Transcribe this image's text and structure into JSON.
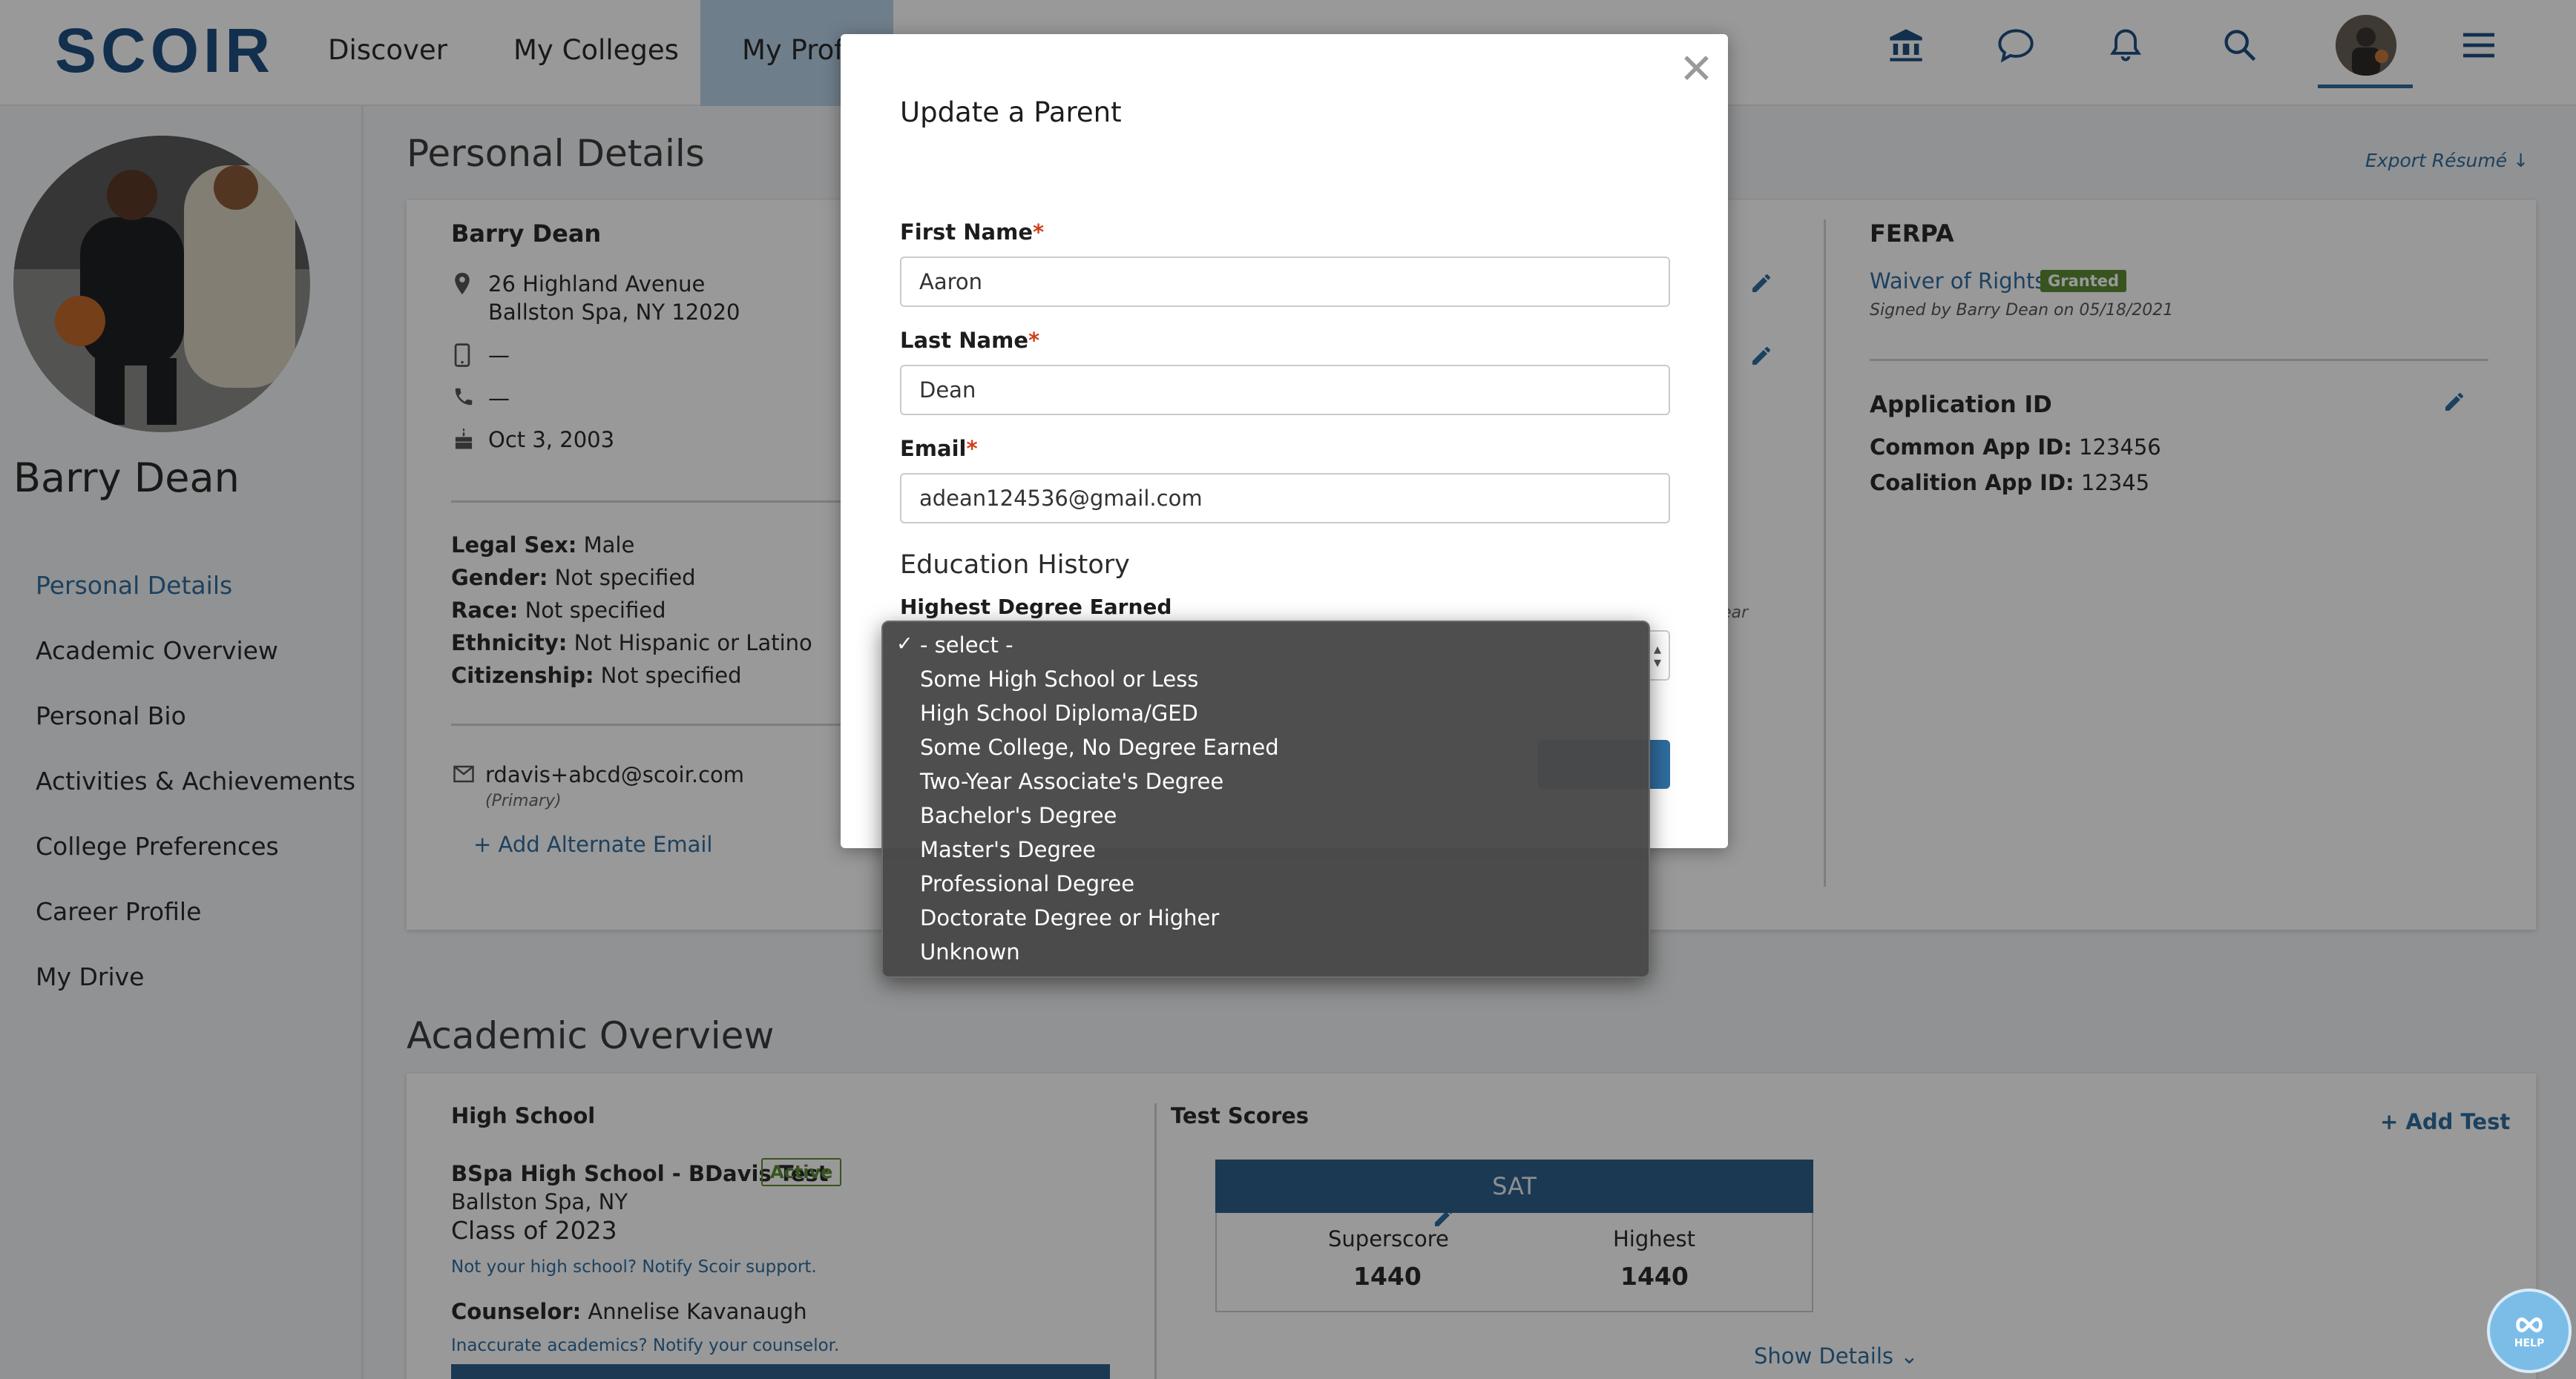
{
  "nav": {
    "logo": "SCOIR",
    "discover": "Discover",
    "my_colleges": "My Colleges",
    "my_profile": "My Profi"
  },
  "sidebar": {
    "name": "Barry Dean",
    "items": [
      {
        "label": "Personal Details"
      },
      {
        "label": "Academic Overview"
      },
      {
        "label": "Personal Bio"
      },
      {
        "label": "Activities & Achievements"
      },
      {
        "label": "College Preferences"
      },
      {
        "label": "Career Profile"
      },
      {
        "label": "My Drive"
      }
    ]
  },
  "personal": {
    "section_title": "Personal Details",
    "export": "Export Résumé",
    "name": "Barry Dean",
    "address1": "26 Highland Avenue",
    "address2": "Ballston Spa, NY 12020",
    "mobile": "—",
    "phone": "—",
    "birthday": "Oct 3, 2003",
    "legal_sex_label": "Legal Sex:",
    "legal_sex": "Male",
    "gender_label": "Gender:",
    "gender": "Not specified",
    "race_label": "Race:",
    "race": "Not specified",
    "ethnicity_label": "Ethnicity:",
    "ethnicity": "Not Hispanic or Latino",
    "citizenship_label": "Citizenship:",
    "citizenship": "Not specified",
    "email": "rdavis+abcd@scoir.com",
    "email_note": "(Primary)",
    "add_email": "Add Alternate Email",
    "partial_note": "ear"
  },
  "ferpa": {
    "title": "FERPA",
    "waiver": "Waiver of Rights",
    "badge": "Granted",
    "signed": "Signed by Barry Dean on 05/18/2021",
    "app_id_title": "Application ID",
    "common_label": "Common App ID:",
    "common_value": "123456",
    "coalition_label": "Coalition App ID:",
    "coalition_value": "12345"
  },
  "academic": {
    "section_title": "Academic Overview",
    "hs_header": "High School",
    "school": "BSpa High School - BDavis Test",
    "status": "Active",
    "location": "Ballston Spa, NY",
    "class_of": "Class of 2023",
    "notify_scoir": "Not your high school? Notify Scoir support.",
    "counselor_label": "Counselor:",
    "counselor": "Annelise Kavanaugh",
    "notify_counselor": "Inaccurate academics? Notify your counselor.",
    "test_header": "Test Scores",
    "add_test": "Add Test",
    "sat_title": "SAT",
    "superscore_label": "Superscore",
    "superscore": "1440",
    "highest_label": "Highest",
    "highest": "1440",
    "show_details": "Show Details"
  },
  "modal": {
    "title": "Update a Parent",
    "first_name_label": "First Name",
    "first_name": "Aaron",
    "last_name_label": "Last Name",
    "last_name": "Dean",
    "email_label": "Email",
    "email": "adean124536@gmail.com",
    "education_title": "Education History",
    "degree_label": "Highest Degree Earned",
    "required_mark": "*"
  },
  "dropdown": {
    "options": [
      {
        "label": "- select -",
        "selected": true
      },
      {
        "label": "Some High School or Less"
      },
      {
        "label": "High School Diploma/GED"
      },
      {
        "label": "Some College, No Degree Earned"
      },
      {
        "label": "Two-Year Associate's Degree"
      },
      {
        "label": "Bachelor's Degree"
      },
      {
        "label": "Master's Degree"
      },
      {
        "label": "Professional Degree"
      },
      {
        "label": "Doctorate Degree or Higher"
      },
      {
        "label": "Unknown"
      }
    ]
  },
  "help": {
    "label": "HELP"
  },
  "colors": {
    "brand": "#1e4f80",
    "accent": "#2f6d9f",
    "required": "#d0401b",
    "success": "#5d8c35"
  },
  "icons": [
    "institution-icon",
    "chat-icon",
    "bell-icon",
    "search-icon",
    "menu-icon",
    "location-icon",
    "mobile-icon",
    "phone-icon",
    "cake-icon",
    "mail-icon",
    "plus-icon",
    "edit-icon",
    "download-icon",
    "chevron-down-icon",
    "close-icon",
    "check-icon",
    "help-icon"
  ]
}
